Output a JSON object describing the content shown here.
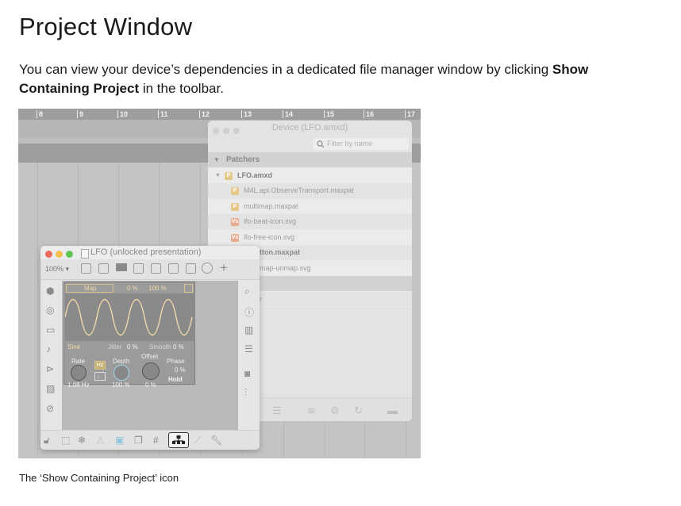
{
  "page": {
    "heading": "Project Window",
    "para_pre": "You can view your device’s dependencies in a dedicated file manager window by clicking ",
    "para_bold": "Show Containing Project",
    "para_post": " in the toolbar.",
    "caption": "The ‘Show Containing Project’ icon"
  },
  "ruler": [
    "8",
    "9",
    "10",
    "11",
    "12",
    "13",
    "14",
    "15",
    "16",
    "17"
  ],
  "device_window": {
    "title": "Device (LFO.amxd)",
    "filter_placeholder": "Filter by name",
    "group_label": "Patchers",
    "rows": [
      {
        "label": "LFO.amxd",
        "icon": "patcher-icon",
        "bold": true
      },
      {
        "label": "M4L.api.ObserveTransport.maxpat",
        "icon": "patcher-icon"
      },
      {
        "label": "multimap.maxpat",
        "icon": "patcher-icon"
      },
      {
        "label": "lfo-beat-icon.svg",
        "icon": "svg-file-icon"
      },
      {
        "label": "lfo-free-icon.svg",
        "icon": "svg-file-icon"
      },
      {
        "label": "tton.maxpat",
        "icon": "none"
      },
      {
        "label": "map-unmap.svg",
        "icon": "none"
      },
      {
        "label": "",
        "icon": "none"
      },
      {
        "label": "r",
        "icon": "none"
      }
    ]
  },
  "lfo_window": {
    "title": "LFO (unlocked presentation)",
    "zoom": "100%",
    "map_label": "Map",
    "map_min": "0 %",
    "map_max": "100 %",
    "wave_label": "Sine",
    "jitter_label": "Jitter",
    "jitter_value": "0 %",
    "smooth_label": "Smooth",
    "smooth_value": "0 %",
    "rate_label": "Rate",
    "rate_value": "1.08 Hz",
    "hz_btn": "Hz",
    "note_btn": "♩",
    "depth_label": "Depth",
    "depth_value": "100 %",
    "offset_label": "Offset",
    "offset_value": "0 %",
    "phase_label": "Phase",
    "phase_value": "0 %",
    "hold_label": "Hold"
  },
  "colors": {
    "wave": "#f2d9a6",
    "panel_bg": "#9b9b9b",
    "highlight": "#9fd3e8"
  }
}
